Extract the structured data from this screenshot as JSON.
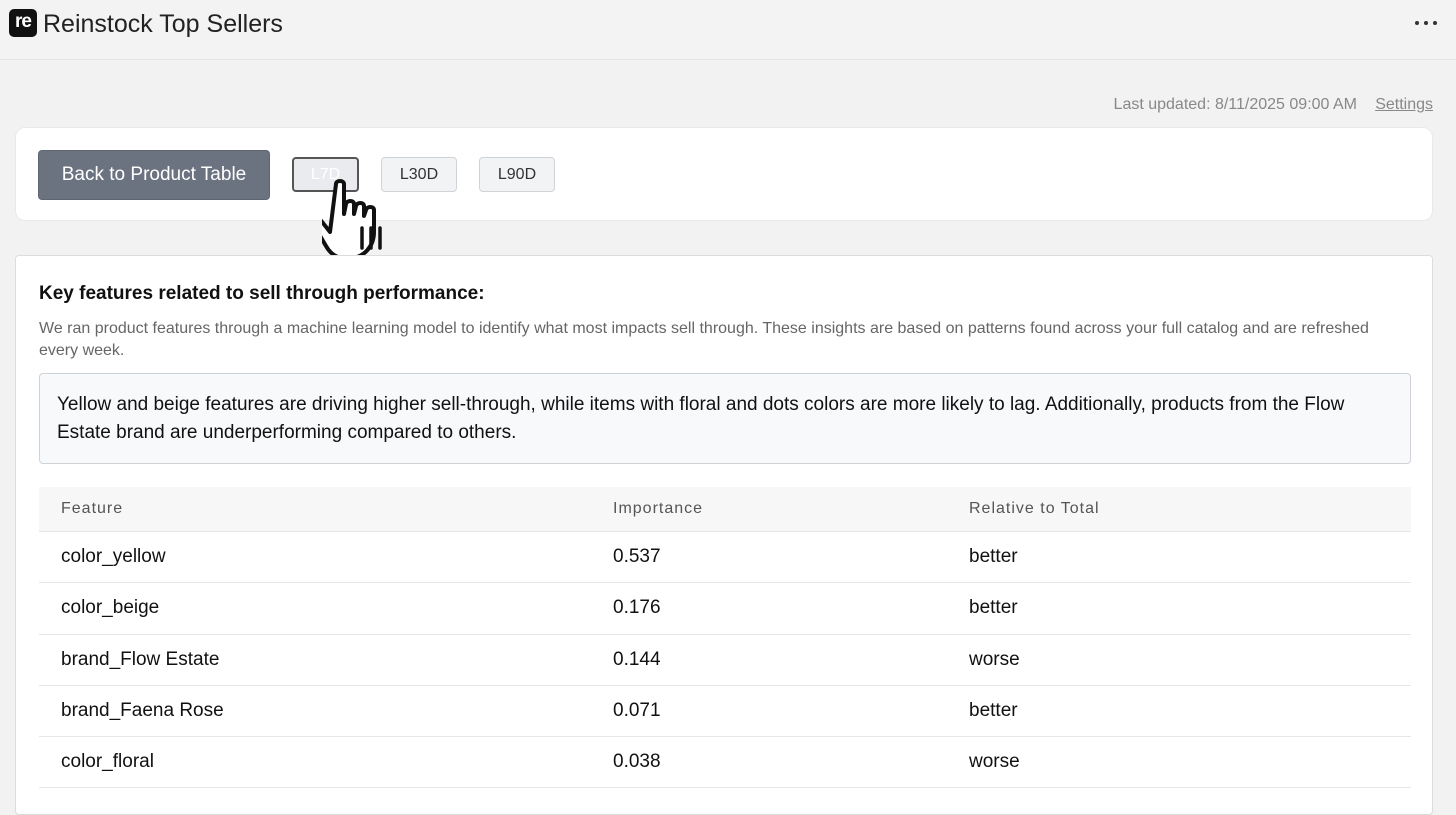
{
  "app": {
    "logo_text": "re",
    "title": "Reinstock Top Sellers"
  },
  "status": {
    "last_updated": "Last updated: 8/11/2025 09:00 AM",
    "settings_label": "Settings"
  },
  "toolbar": {
    "back_label": "Back to Product Table",
    "ranges": [
      {
        "label": "L7D",
        "active": true
      },
      {
        "label": "L30D",
        "active": false
      },
      {
        "label": "L90D",
        "active": false
      }
    ]
  },
  "insights": {
    "title": "Key features related to sell through performance:",
    "description": "We ran product features through a machine learning model to identify what most impacts sell through. These insights are based on patterns found across your full catalog and are refreshed every week.",
    "summary": "Yellow and beige features are driving higher sell-through, while items with floral and dots colors are more likely to lag. Additionally, products from the Flow Estate brand are underperforming compared to others."
  },
  "table": {
    "columns": [
      "Feature",
      "Importance",
      "Relative to Total"
    ],
    "rows": [
      [
        "color_yellow",
        "0.537",
        "better"
      ],
      [
        "color_beige",
        "0.176",
        "better"
      ],
      [
        "brand_Flow Estate",
        "0.144",
        "worse"
      ],
      [
        "brand_Faena Rose",
        "0.071",
        "better"
      ],
      [
        "color_floral",
        "0.038",
        "worse"
      ]
    ]
  },
  "icons": {
    "menu": "more-horizontal-icon",
    "cursor": "hand-pointer-icon"
  }
}
